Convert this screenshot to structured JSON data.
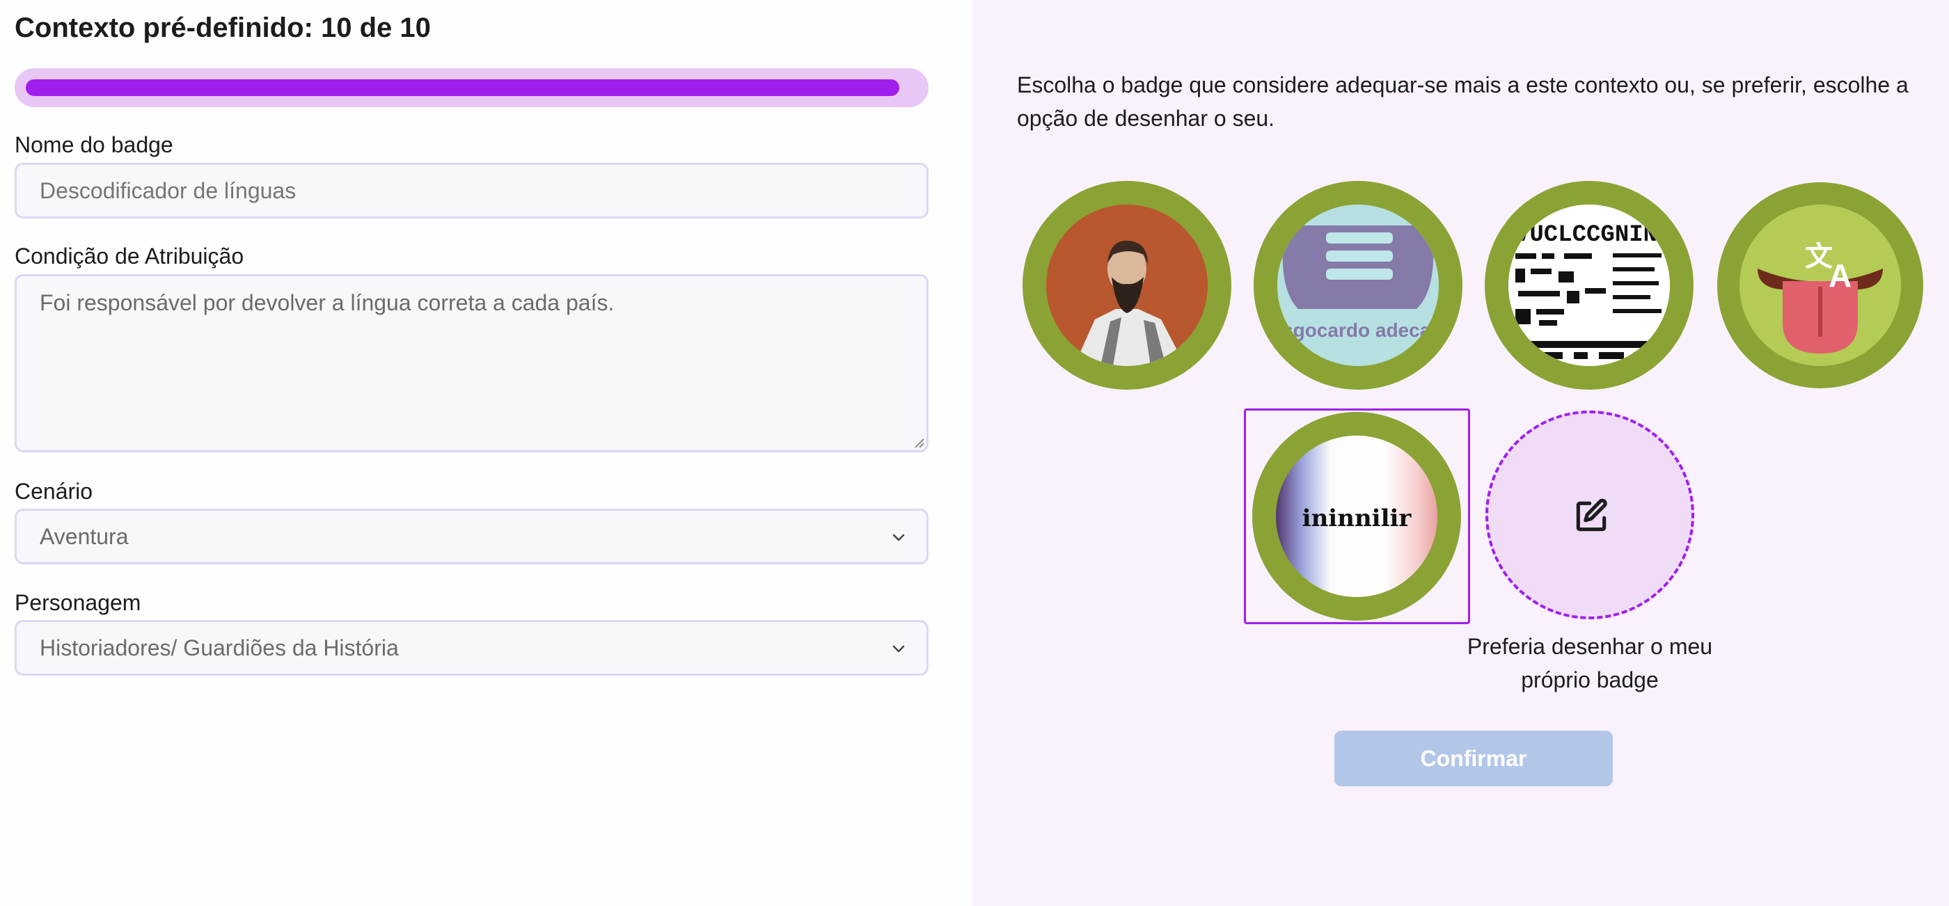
{
  "header": {
    "title": "Contexto pré-definido: 10 de 10",
    "progress_fraction": 0.98
  },
  "form": {
    "badge_name": {
      "label": "Nome do badge",
      "placeholder": "Descodificador de línguas"
    },
    "condition": {
      "label": "Condição de Atribuição",
      "placeholder": "Foi responsável por devolver a língua correta a cada país."
    },
    "scenario": {
      "label": "Cenário",
      "value": "Aventura"
    },
    "character": {
      "label": "Personagem",
      "value": "Historiadores/ Guardiões da História"
    }
  },
  "picker": {
    "intro": "Escolha o badge que considere adequar-se mais a este contexto ou, se preferir, escolhe a opção de desenhar o seu.",
    "badges": [
      {
        "icon": "bearded-man-portrait-icon"
      },
      {
        "icon": "message-bubble-lines-icon",
        "text": "Liitasgocardo adecagrdo"
      },
      {
        "icon": "encoded-text-pattern-icon",
        "text": "VUCLCCGNINA"
      },
      {
        "icon": "tongue-translate-icon"
      },
      {
        "icon": "flag-word-icon",
        "text": "ininnilir",
        "selected": true
      }
    ],
    "draw_option": {
      "icon": "edit-square-icon",
      "label": "Preferia desenhar o meu próprio badge"
    },
    "confirm_label": "Confirmar"
  },
  "colors": {
    "accent": "#a11fec",
    "progress_track": "#e8c7f7",
    "badge_ring": "#8ba334",
    "panel_bg": "#f9f1fb",
    "confirm_disabled": "#b2c6e8"
  }
}
